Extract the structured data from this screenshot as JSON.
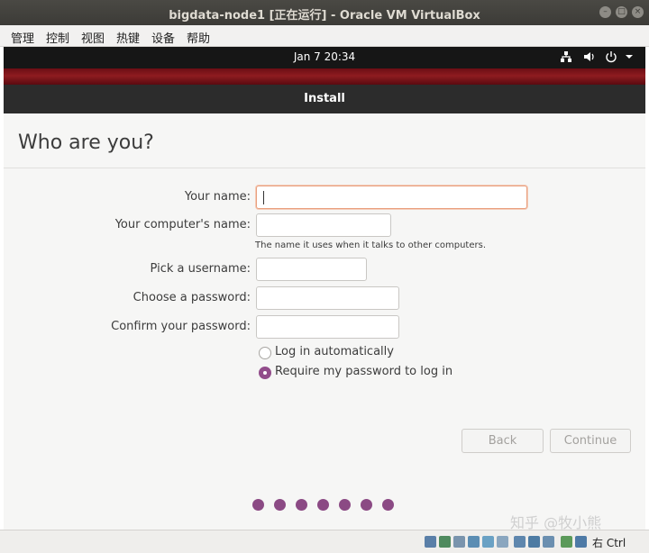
{
  "host": {
    "title": "bigdata-node1 [正在运行] - Oracle VM VirtualBox",
    "menu": [
      "管理",
      "控制",
      "视图",
      "热键",
      "设备",
      "帮助"
    ],
    "statusbar_text": "右 Ctrl"
  },
  "guest_panel": {
    "clock": "Jan 7  20:34"
  },
  "installer": {
    "header": "Install",
    "title": "Who are you?",
    "form": {
      "your_name_label": "Your name:",
      "your_name_value": "",
      "computer_name_label": "Your computer's name:",
      "computer_name_value": "",
      "computer_name_hint": "The name it uses when it talks to other computers.",
      "username_label": "Pick a username:",
      "username_value": "",
      "password_label": "Choose a password:",
      "password_value": "",
      "confirm_label": "Confirm your password:",
      "confirm_value": ""
    },
    "login_options": [
      {
        "label": "Log in automatically",
        "selected": false
      },
      {
        "label": "Require my password to log in",
        "selected": true
      }
    ],
    "buttons": {
      "back": "Back",
      "continue": "Continue"
    },
    "progress_dots": 7
  },
  "colors": {
    "accent": "#924d8b",
    "header_bg": "#2c2c2c",
    "focus": "#e9a07f"
  },
  "watermark": "知乎 @牧小熊"
}
